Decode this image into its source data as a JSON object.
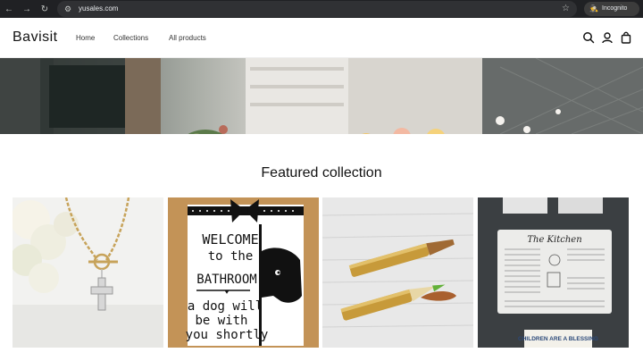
{
  "browser": {
    "url": "yusales.com",
    "incognito_label": "Incognito"
  },
  "store": {
    "name": "Bavisit",
    "nav": [
      "Home",
      "Collections",
      "All products"
    ]
  },
  "section": {
    "title": "Featured collection"
  },
  "products": [
    {
      "image": "cross-necklace"
    },
    {
      "image": "bathroom-sign",
      "sign_text": {
        "line1": "WELCOME",
        "line2": "to the",
        "line3": "BATHROOM",
        "line4": "a dog will",
        "line5": "be with",
        "line6": "you shortly"
      }
    },
    {
      "image": "bullet-pen"
    },
    {
      "image": "kitchen-magnet",
      "magnet_title": "The Kitchen",
      "card_text": "CHILDREN ARE A BLESSING"
    }
  ]
}
